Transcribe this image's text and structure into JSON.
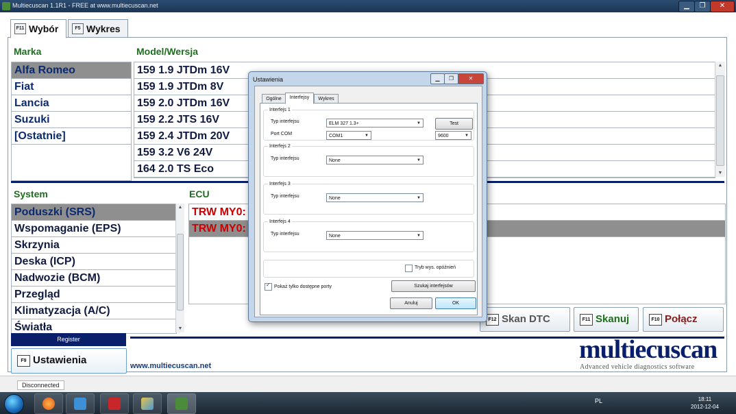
{
  "window": {
    "title": "Multiecuscan 1.1R1 - FREE at www.multiecuscan.net",
    "min": "▁",
    "max": "❐",
    "close": "✕"
  },
  "tabs": [
    {
      "key": "F11",
      "label": "Wybór"
    },
    {
      "key": "F5",
      "label": "Wykres"
    }
  ],
  "headers": {
    "marka": "Marka",
    "model": "Model/Wersja",
    "system": "System",
    "ecu": "ECU"
  },
  "marka": {
    "items": [
      "Alfa Romeo",
      "Fiat",
      "Lancia",
      "Suzuki",
      "[Ostatnie]"
    ],
    "selected": 0
  },
  "model": {
    "items": [
      "159 1.9 JTDm 16V",
      "159 1.9 JTDm 8V",
      "159 2.0 JTDm 16V",
      "159 2.2 JTS 16V",
      "159 2.4 JTDm 20V",
      "159 3.2 V6 24V",
      "164 2.0 TS Eco"
    ]
  },
  "system": {
    "items": [
      "Poduszki (SRS)",
      "Wspomaganie (EPS)",
      "Skrzynia",
      "Deska (ICP)",
      "Nadwozie (BCM)",
      "Przegląd",
      "Klimatyzacja (A/C)",
      "Światła"
    ],
    "selected": 0
  },
  "ecu": {
    "items": [
      "TRW MY0:",
      "TRW MY0:"
    ]
  },
  "actions": {
    "skan_dtc": {
      "key": "F12",
      "label": "Skan DTC"
    },
    "skanuj": {
      "key": "F11",
      "label": "Skanuj"
    },
    "polacz": {
      "key": "F10",
      "label": "Połącz"
    }
  },
  "register_label": "Register",
  "settings_button": {
    "key": "F9",
    "label": "Ustawienia"
  },
  "website": "www.multiecuscan.net",
  "brand": {
    "name": "multiecuscan",
    "tagline": "Advanced vehicle diagnostics software"
  },
  "status": "Disconnected",
  "taskbar": {
    "tray": "PL",
    "time": "18:11",
    "date": "2012-12-04"
  },
  "dialog": {
    "title": "Ustawienia",
    "tabs": [
      "Ogólne",
      "Interfejsy",
      "Wykres"
    ],
    "interfejs1": {
      "legend": "Interfejs 1",
      "typ_label": "Typ interfejsu",
      "typ_value": "ELM 327 1.3+",
      "port_label": "Port COM",
      "port_value": "COM1",
      "baud_value": "9600",
      "test_label": "Test"
    },
    "interfejs2": {
      "legend": "Interfejs 2",
      "typ_label": "Typ interfejsu",
      "typ_value": "None"
    },
    "interfejs3": {
      "legend": "Interfejs 3",
      "typ_label": "Typ interfejsu",
      "typ_value": "None"
    },
    "interfejs4": {
      "legend": "Interfejs 4",
      "typ_label": "Typ interfejsu",
      "typ_value": "None"
    },
    "tryb_label": "Tryb wys. opóźnień",
    "pokaz_label": "Pokaż tylko dostępne porty",
    "pokaz_checked": true,
    "szukaj_label": "Szukaj interfejsów",
    "anuluj_label": "Anuluj",
    "ok_label": "OK"
  },
  "colors": {
    "accent_navy": "#0a1f6a",
    "header_green": "#1e6e1e",
    "ecu_red": "#cc0000",
    "selected_gray": "#8f8f8f"
  }
}
